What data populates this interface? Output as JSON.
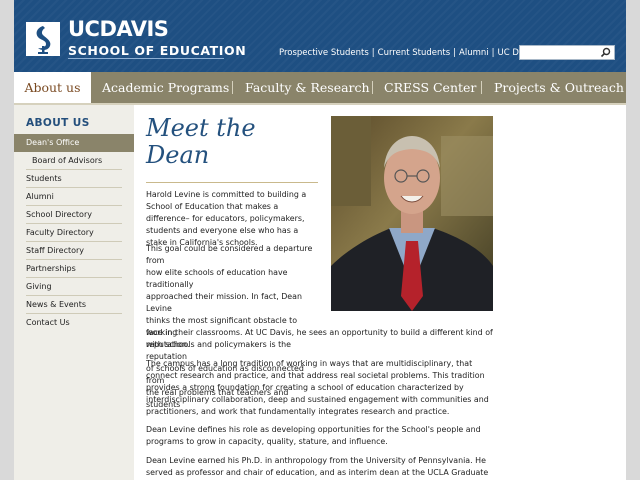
{
  "header": {
    "logo_uc": "UC",
    "logo_davis": "DAVIS",
    "logo_school": "SCHOOL OF EDUCATION",
    "toplinks": [
      "Prospective Students",
      "Current Students",
      "Alumni",
      "UC Davis"
    ],
    "search": {
      "placeholder": "",
      "value": ""
    },
    "brand_color": "#1e4f82"
  },
  "nav": {
    "items": [
      "About us",
      "Academic Programs",
      "Faculty & Research",
      "CRESS Center",
      "Projects & Outreach"
    ],
    "active": "About us"
  },
  "sidebar": {
    "title": "ABOUT US",
    "items": [
      {
        "label": "Dean's Office",
        "active": true
      },
      {
        "label": "Board of Advisors",
        "sub": true
      },
      {
        "label": "Students"
      },
      {
        "label": "Alumni"
      },
      {
        "label": "School Directory"
      },
      {
        "label": "Faculty Directory"
      },
      {
        "label": "Staff Directory"
      },
      {
        "label": "Partnerships"
      },
      {
        "label": "Giving"
      },
      {
        "label": "News & Events"
      },
      {
        "label": "Contact Us"
      }
    ]
  },
  "main": {
    "title": "Meet the Dean",
    "paragraphs": [
      "Harold Levine is committed to building a School of Education that makes a difference– for educators, policymakers, students and everyone else who has a stake in California's schools.",
      "This goal could be considered a departure from how elite schools of education have traditionally approached their mission. In fact, Dean Levine thinks the most significant obstacle to working with schools and policymakers is the reputation of schools of education as disconnected from the real problems that teachers and students face in their classrooms. At UC Davis, he sees an opportunity to build a different kind of reputation.",
      "The campus has a long tradition of working in ways that are multidisciplinary, that connect research and practice, and that address real societal problems. This tradition provides a strong foundation for creating a school of education characterized by interdisciplinary collaboration, deep and sustained engagement with communities and practitioners, and work that fundamentally integrates research and practice.",
      "Dean Levine defines his role as developing opportunities for the School's people and programs to grow in capacity, quality, stature, and influence.",
      "Dean Levine earned his Ph.D. in anthropology from the University of Pennsylvania. He served as professor and chair of education, and as interim dean at the UCLA Graduate School of Education"
    ],
    "p2_lines": [
      "This goal could be considered a departure from",
      "how elite schools of education have traditionally",
      "approached their mission. In fact, Dean Levine",
      "thinks the most significant obstacle to working",
      "with schools and policymakers is the reputation",
      "of schools of education as disconnected from",
      "the real problems that teachers and students"
    ],
    "p2_tail": "face in their classrooms. At UC Davis, he sees an opportunity to build a different kind of reputation."
  }
}
